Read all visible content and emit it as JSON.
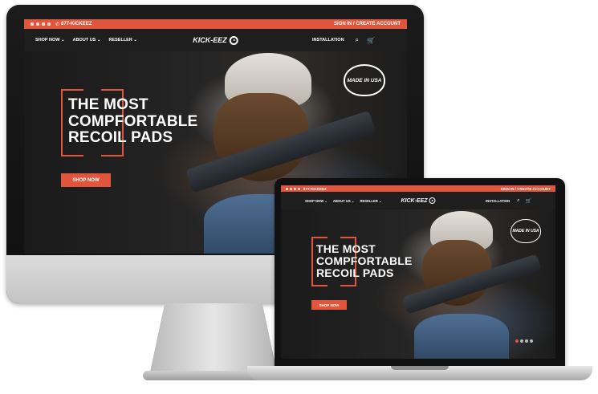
{
  "site": {
    "topbar": {
      "phone": "877-KICKEEZ",
      "account_links": "SIGN IN / CREATE ACCOUNT"
    },
    "nav": {
      "items": [
        "SHOP NOW",
        "ABOUT US",
        "RESELLER"
      ],
      "logo_text": "KICK-EEZ",
      "installation": "INSTALLATION"
    },
    "hero": {
      "headline_line1": "THE MOST",
      "headline_line2": "COMPFORTABLE",
      "headline_line3": "RECOIL PADS",
      "cta": "SHOP NOW",
      "badge": "MADE IN USA"
    },
    "slider": {
      "count": 4,
      "active": 1
    }
  },
  "colors": {
    "accent": "#e0553b",
    "nav_bg": "#1e1e1e",
    "hero_bg": "#222222"
  }
}
